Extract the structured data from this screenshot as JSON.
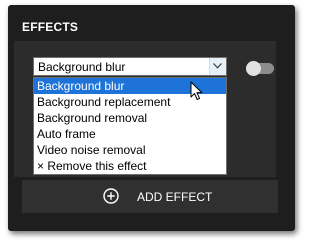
{
  "panel": {
    "title": "EFFECTS"
  },
  "effect_select": {
    "value": "Background blur",
    "options": [
      "Background blur",
      "Background replacement",
      "Background removal",
      "Auto frame",
      "Video noise removal",
      "× Remove this effect"
    ],
    "selected_index": 0
  },
  "effect_toggle": {
    "state": "off"
  },
  "add_effect": {
    "label": "ADD EFFECT",
    "icon": "plus-circle-icon"
  },
  "colors": {
    "panel_bg": "#1e1e1e",
    "selection": "#1e73d8",
    "toggle_off": "#8c8c8c"
  }
}
